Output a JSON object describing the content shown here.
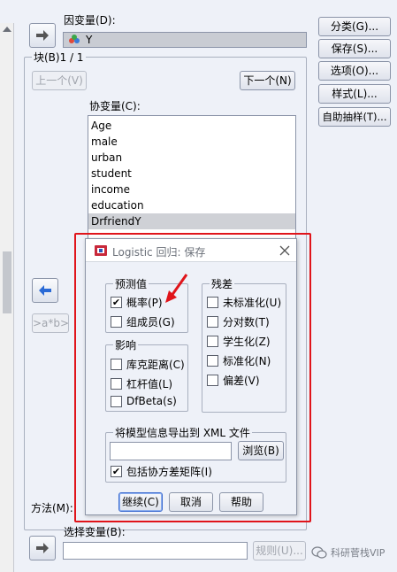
{
  "main": {
    "dependent_label": "因变量(D):",
    "dependent_value": "Y",
    "block_label": "块(B)1 / 1",
    "prev_button": "上一个(V)",
    "next_button": "下一个(N)",
    "covariates_label": "协变量(C):",
    "covariates": [
      "Age",
      "male",
      "urban",
      "student",
      "income",
      "education",
      "DrfriendY"
    ],
    "interaction_button": ">a*b>",
    "method_label": "方法(M):",
    "selection_label": "选择变量(B):",
    "rule_button": "规则(U)...",
    "watermark": "科研菅栈VIP"
  },
  "side_buttons": {
    "categorical": "分类(G)...",
    "save": "保存(S)...",
    "options": "选项(O)...",
    "style": "样式(L)...",
    "bootstrap": "自助抽样(T)..."
  },
  "dialog": {
    "title": "Logistic 回归: 保存",
    "predicted": {
      "title": "预测值",
      "probability": "概率(P)",
      "group_membership": "组成员(G)"
    },
    "residuals": {
      "title": "残差",
      "unstandardized": "未标准化(U)",
      "logit": "分对数(T)",
      "studentized": "学生化(Z)",
      "standardized": "标准化(N)",
      "deviance": "偏差(V)"
    },
    "influence": {
      "title": "影响",
      "cooks": "库克距离(C)",
      "leverage": "杠杆值(L)",
      "dfbeta": "DfBeta(s)"
    },
    "export": {
      "title": "将模型信息导出到 XML 文件",
      "browse": "浏览(B)",
      "include_cov": "包括协方差矩阵(I)",
      "file_value": ""
    },
    "buttons": {
      "continue": "继续(C)",
      "cancel": "取消",
      "help": "帮助"
    }
  },
  "colors": {
    "highlight_border": "#e0141a",
    "accent_arrow": "#2a6ad6"
  }
}
